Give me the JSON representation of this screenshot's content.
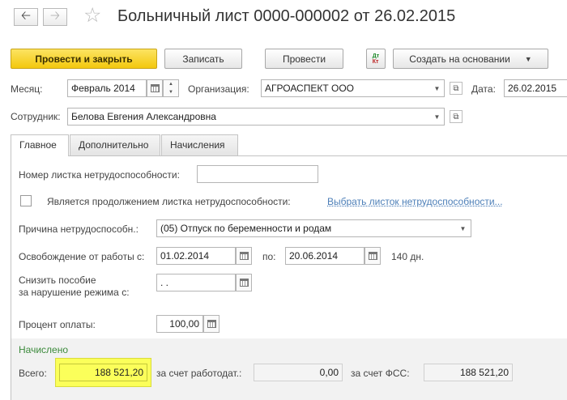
{
  "title": "Больничный лист 0000-000002 от 26.02.2015",
  "icons": {
    "back": "arrow-left-icon",
    "forward": "arrow-right-icon",
    "favorite": "star-icon"
  },
  "toolbar": {
    "post_close": "Провести и закрыть",
    "save": "Записать",
    "post": "Провести",
    "dtkt_top": "Дт",
    "dtkt_bottom": "Кт",
    "create_based": "Создать на основании"
  },
  "header": {
    "month_label": "Месяц:",
    "month_value": "Февраль 2014",
    "org_label": "Организация:",
    "org_value": "АГРОАСПЕКТ ООО",
    "date_label": "Дата:",
    "date_value": "26.02.2015",
    "employee_label": "Сотрудник:",
    "employee_value": "Белова Евгения Александровна"
  },
  "tabs": [
    {
      "label": "Главное"
    },
    {
      "label": "Дополнительно"
    },
    {
      "label": "Начисления"
    }
  ],
  "main": {
    "sheet_number_label": "Номер листка нетрудоспособности:",
    "sheet_number_value": "",
    "continuation_label": "Является продолжением листка нетрудоспособности:",
    "continuation_link": "Выбрать листок нетрудоспособности...",
    "reason_label": "Причина нетрудоспособн.:",
    "reason_value": "(05) Отпуск по беременности и родам",
    "release_label": "Освобождение от работы с:",
    "release_from": "01.02.2014",
    "to_label": "по:",
    "release_to": "20.06.2014",
    "days_text": "140 дн.",
    "reduce_label_1": "Снизить пособие",
    "reduce_label_2": "за нарушение режима с:",
    "reduce_value": " .  .",
    "percent_label": "Процент оплаты:",
    "percent_value": "100,00"
  },
  "accrued": {
    "group_title": "Начислено",
    "total_label": "Всего:",
    "total_value": "188 521,20",
    "employer_label": "за счет работодат.:",
    "employer_value": "0,00",
    "fss_label": "за счет ФСС:",
    "fss_value": "188 521,20"
  },
  "colors": {
    "primary_button": "#f5cd1a",
    "link": "#4d7fb8",
    "group_title": "#3b8a3b",
    "highlight": "#fbff5a"
  }
}
